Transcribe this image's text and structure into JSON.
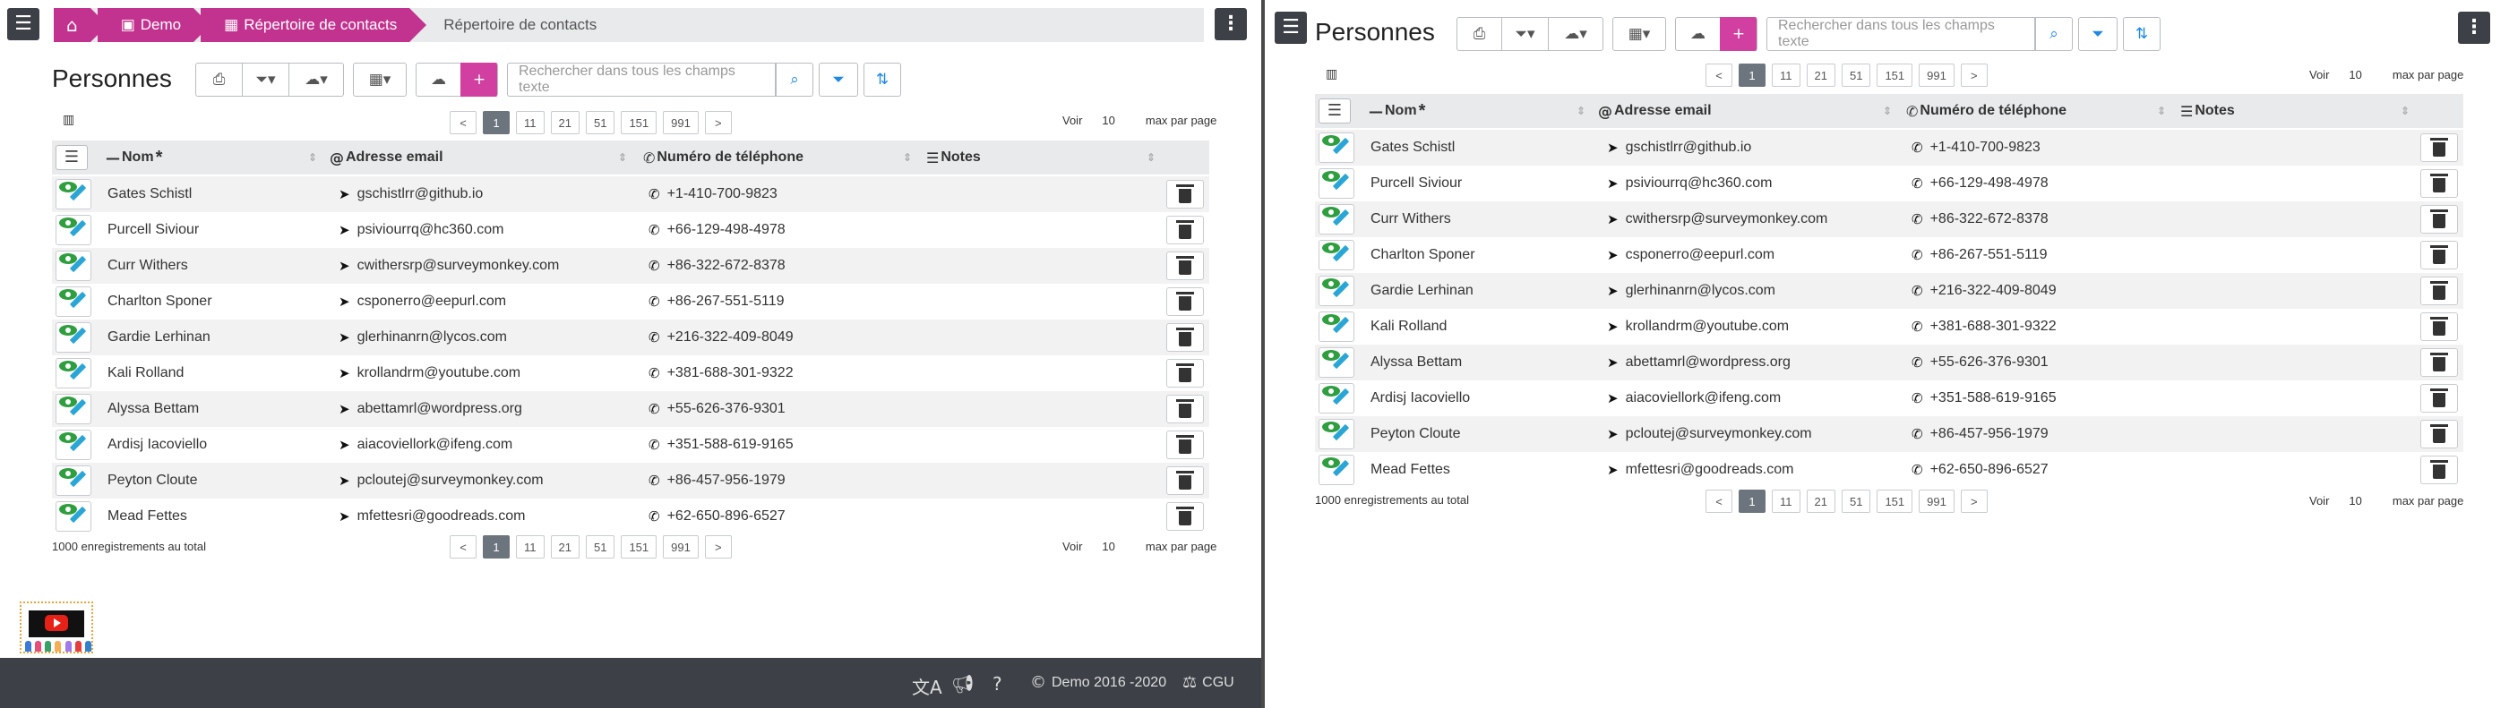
{
  "left": {
    "breadcrumb": {
      "demo": "Demo",
      "repertoire": "Répertoire de contacts",
      "current": "Répertoire de contacts"
    },
    "footer": {
      "copyright": "Demo 2016 -2020",
      "cgu": "CGU"
    }
  },
  "page_title": "Personnes",
  "search_placeholder": "Rechercher dans tous les champs texte",
  "pagination": {
    "pages": [
      "1",
      "11",
      "21",
      "51",
      "151",
      "991"
    ],
    "prev": "<",
    "next": ">"
  },
  "show": {
    "label": "Voir",
    "value": "10",
    "suffix": "max par page"
  },
  "total": "1000 enregistrements au total",
  "columns": {
    "nom": "Nom",
    "email": "Adresse email",
    "phone": "Numéro de téléphone",
    "notes": "Notes"
  },
  "rows": [
    {
      "nom": "Gates Schistl",
      "email": "gschistlrr@github.io",
      "phone": "+1-410-700-9823"
    },
    {
      "nom": "Purcell Siviour",
      "email": "psiviourrq@hc360.com",
      "phone": "+66-129-498-4978"
    },
    {
      "nom": "Curr Withers",
      "email": "cwithersrp@surveymonkey.com",
      "phone": "+86-322-672-8378"
    },
    {
      "nom": "Charlton Sponer",
      "email": "csponerro@eepurl.com",
      "phone": "+86-267-551-5119"
    },
    {
      "nom": "Gardie Lerhinan",
      "email": "glerhinanrn@lycos.com",
      "phone": "+216-322-409-8049"
    },
    {
      "nom": "Kali Rolland",
      "email": "krollandrm@youtube.com",
      "phone": "+381-688-301-9322"
    },
    {
      "nom": "Alyssa Bettam",
      "email": "abettamrl@wordpress.org",
      "phone": "+55-626-376-9301"
    },
    {
      "nom": "Ardisj Iacoviello",
      "email": "aiacoviellork@ifeng.com",
      "phone": "+351-588-619-9165"
    },
    {
      "nom": "Peyton Cloute",
      "email": "pcloutej@surveymonkey.com",
      "phone": "+86-457-956-1979"
    },
    {
      "nom": "Mead Fettes",
      "email": "mfettesri@goodreads.com",
      "phone": "+62-650-896-6527"
    }
  ],
  "icons": {
    "menu": "hamburger-icon",
    "kebab": "vertical-dots-icon",
    "home": "home-icon",
    "print": "print-icon",
    "filter": "filter-icon",
    "cloud": "cloud-download-icon",
    "table": "table-icon",
    "upload": "cloud-upload-icon",
    "add": "plus-icon",
    "search": "search-icon"
  },
  "colors": {
    "accent": "#c2338f",
    "add": "#d13fa0",
    "dark": "#3d4147",
    "edit_eye": "#2e9e3f",
    "edit_pen": "#29a6d6",
    "blue": "#1e88e5"
  }
}
